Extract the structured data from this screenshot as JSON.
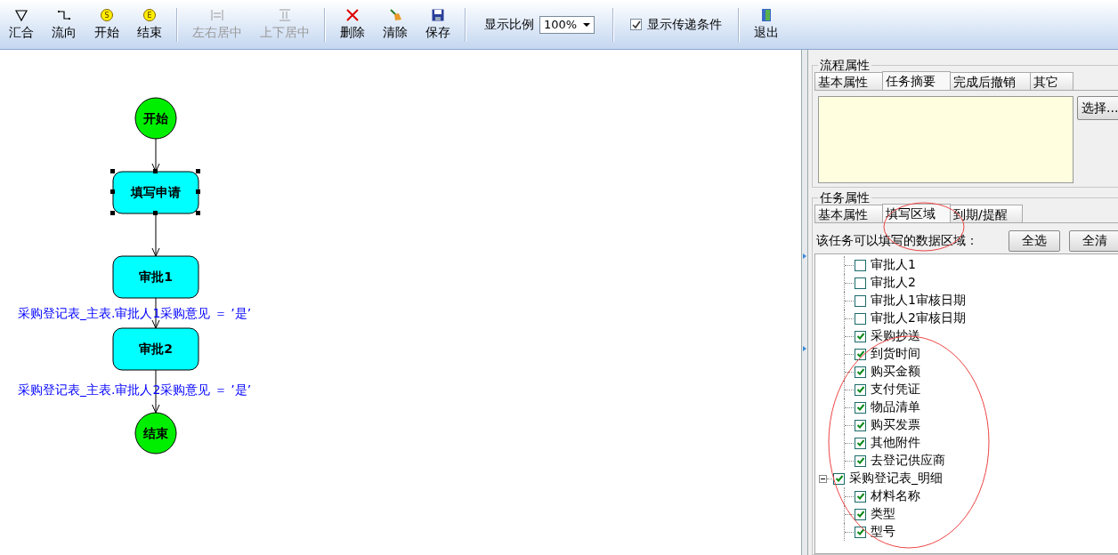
{
  "toolbar": [
    {
      "kind": "button",
      "label": "汇合",
      "disabled": false
    },
    {
      "kind": "button",
      "label": "流向",
      "disabled": false
    },
    {
      "kind": "button",
      "badge": "S",
      "label": "开始",
      "disabled": false
    },
    {
      "kind": "button",
      "badge": "E",
      "label": "结束",
      "disabled": false
    },
    {
      "kind": "separator"
    },
    {
      "kind": "button",
      "label": "左右居中",
      "disabled": true
    },
    {
      "kind": "button",
      "label": "上下居中",
      "disabled": true
    },
    {
      "kind": "separator"
    },
    {
      "kind": "button",
      "label": "删除",
      "disabled": false
    },
    {
      "kind": "button",
      "label": "清除",
      "disabled": false
    },
    {
      "kind": "button",
      "label": "保存",
      "disabled": false
    },
    {
      "kind": "separator"
    },
    {
      "kind": "zoom",
      "label": "显示比例",
      "value": "100%"
    },
    {
      "kind": "separator"
    },
    {
      "kind": "checkbox",
      "label": "显示传递条件",
      "checked": true
    },
    {
      "kind": "separator"
    },
    {
      "kind": "button",
      "label": "退出",
      "disabled": false
    }
  ],
  "diagram": {
    "nodes": [
      {
        "kind": "start",
        "label": "开始",
        "selected": false
      },
      {
        "kind": "task",
        "label": "填写申请",
        "selected": true
      },
      {
        "kind": "task",
        "label": "审批1",
        "selected": false
      },
      {
        "kind": "task",
        "label": "审批2",
        "selected": false
      },
      {
        "kind": "end",
        "label": "结束",
        "selected": false
      }
    ],
    "conditions": [
      "采购登记表_主表.审批人1采购意见 ＝ ’是’",
      "采购登记表_主表.审批人2采购意见 ＝ ’是’"
    ]
  },
  "process_properties": {
    "title": "流程属性",
    "tabs": [
      {
        "label": "基本属性",
        "selected": false
      },
      {
        "label": "任务摘要",
        "selected": true
      },
      {
        "label": "完成后撤销",
        "selected": false
      },
      {
        "label": "其它",
        "selected": false
      }
    ],
    "select_button": "选择..."
  },
  "task_properties": {
    "title": "任务属性",
    "tabs": [
      {
        "label": "基本属性",
        "selected": false
      },
      {
        "label": "填写区域",
        "selected": true
      },
      {
        "label": "到期/提醒",
        "selected": false
      }
    ],
    "caption": "该任务可以填写的数据区域：",
    "buttons": [
      "全选",
      "全清"
    ],
    "tree": [
      {
        "children": [
          {
            "label": "审批人1",
            "checked": false
          },
          {
            "label": "审批人2",
            "checked": false
          },
          {
            "label": "审批人1审核日期",
            "checked": false
          },
          {
            "label": "审批人2审核日期",
            "checked": false
          },
          {
            "label": "采购抄送",
            "checked": true
          },
          {
            "label": "到货时间",
            "checked": true
          },
          {
            "label": "购买金额",
            "checked": true
          },
          {
            "label": "支付凭证",
            "checked": true
          },
          {
            "label": "物品清单",
            "checked": true
          },
          {
            "label": "购买发票",
            "checked": true
          },
          {
            "label": "其他附件",
            "checked": true
          },
          {
            "label": "去登记供应商",
            "checked": true
          }
        ]
      },
      {
        "label": "采购登记表_明细",
        "checked": true,
        "expanded": true,
        "children": [
          {
            "label": "材料名称",
            "checked": true
          },
          {
            "label": "类型",
            "checked": true
          },
          {
            "label": "型号",
            "checked": true
          }
        ]
      }
    ]
  }
}
